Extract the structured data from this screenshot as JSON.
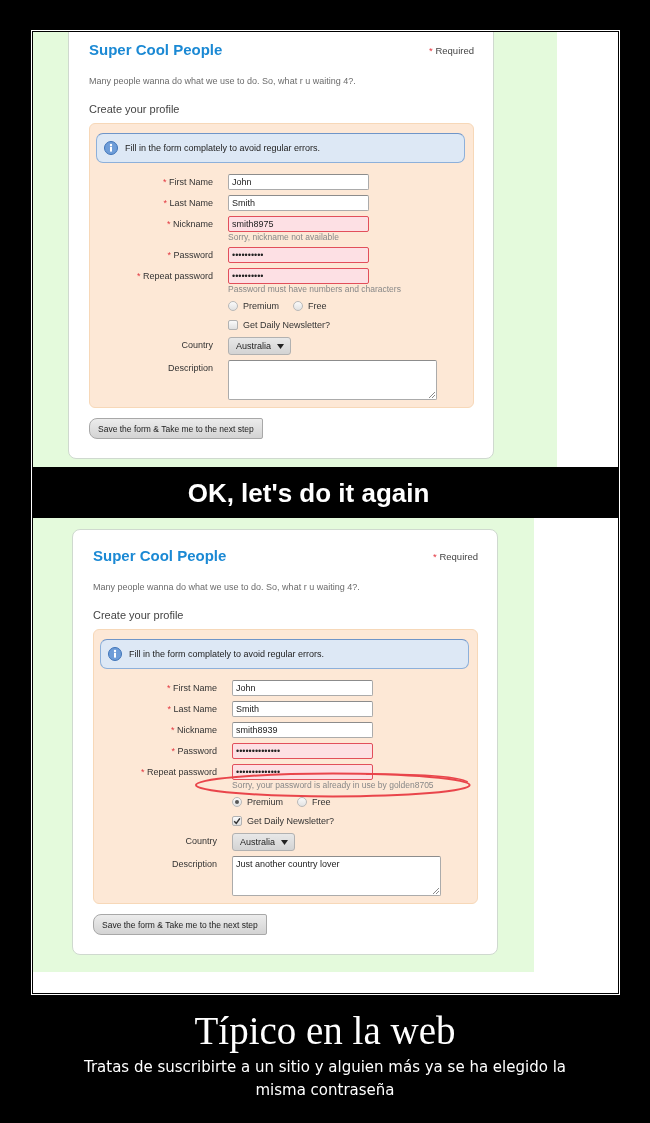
{
  "sections": [
    {
      "kind": "form",
      "title": "Super Cool People",
      "required_note": {
        "mark": "*",
        "label": "Required"
      },
      "intro": "Many people wanna do what we use to do. So, what r u waiting 4?.",
      "heading": "Create your profile",
      "notice": "Fill in the form complately to avoid regular errors.",
      "fields": [
        {
          "kind": "text",
          "mark": "*",
          "label": "First Name",
          "value": "John",
          "invalid": false
        },
        {
          "kind": "text",
          "mark": "*",
          "label": "Last Name",
          "value": "Smith",
          "invalid": false
        },
        {
          "kind": "text",
          "mark": "*",
          "label": "Nickname",
          "value": "smith8975",
          "invalid": true,
          "hint": "Sorry, nickname not available"
        },
        {
          "kind": "password",
          "mark": "*",
          "label": "Password",
          "value": "••••••••••",
          "invalid": true
        },
        {
          "kind": "password",
          "mark": "*",
          "label": "Repeat password",
          "value": "••••••••••",
          "invalid": true,
          "hint": "Password must have numbers and characters"
        },
        {
          "kind": "radio",
          "options": [
            {
              "label": "Premium",
              "selected": false
            },
            {
              "label": "Free",
              "selected": false
            }
          ]
        },
        {
          "kind": "checkbox",
          "label": "Get Daily Newsletter?",
          "checked": false
        },
        {
          "kind": "select",
          "label": "Country",
          "value": "Australia"
        },
        {
          "kind": "textarea",
          "label": "Description"
        }
      ],
      "button": "Save the form & Take me to the next step"
    },
    {
      "kind": "caption",
      "text": "OK, let's do it again"
    },
    {
      "kind": "form",
      "title": "Super Cool People",
      "required_note": {
        "mark": "*",
        "label": "Required"
      },
      "intro": "Many people wanna do what we use to do. So, what r u waiting 4?.",
      "heading": "Create your profile",
      "notice": "Fill in the form complately to avoid regular errors.",
      "fields": [
        {
          "kind": "text",
          "mark": "*",
          "label": "First Name",
          "value": "John",
          "invalid": false
        },
        {
          "kind": "text",
          "mark": "*",
          "label": "Last Name",
          "value": "Smith",
          "invalid": false
        },
        {
          "kind": "text",
          "mark": "*",
          "label": "Nickname",
          "value": "smith8939",
          "invalid": false
        },
        {
          "kind": "password",
          "mark": "*",
          "label": "Password",
          "value": "••••••••••••••",
          "invalid": true
        },
        {
          "kind": "password",
          "mark": "*",
          "label": "Repeat password",
          "value": "••••••••••••••",
          "invalid": true,
          "hint": "Sorry, your password is already in use by golden8705",
          "circled": true
        },
        {
          "kind": "radio",
          "options": [
            {
              "label": "Premium",
              "selected": true
            },
            {
              "label": "Free",
              "selected": false
            }
          ]
        },
        {
          "kind": "checkbox",
          "label": "Get Daily Newsletter?",
          "checked": true
        },
        {
          "kind": "select",
          "label": "Country",
          "value": "Australia"
        },
        {
          "kind": "textarea",
          "label": "Description",
          "value": "Just another country lover"
        }
      ],
      "button": "Save the form & Take me to the next step"
    }
  ],
  "title": "Típico en la web",
  "subtitle": "Tratas de suscribirte a un sitio y alguien más ya se ha elegido la misma contraseña"
}
